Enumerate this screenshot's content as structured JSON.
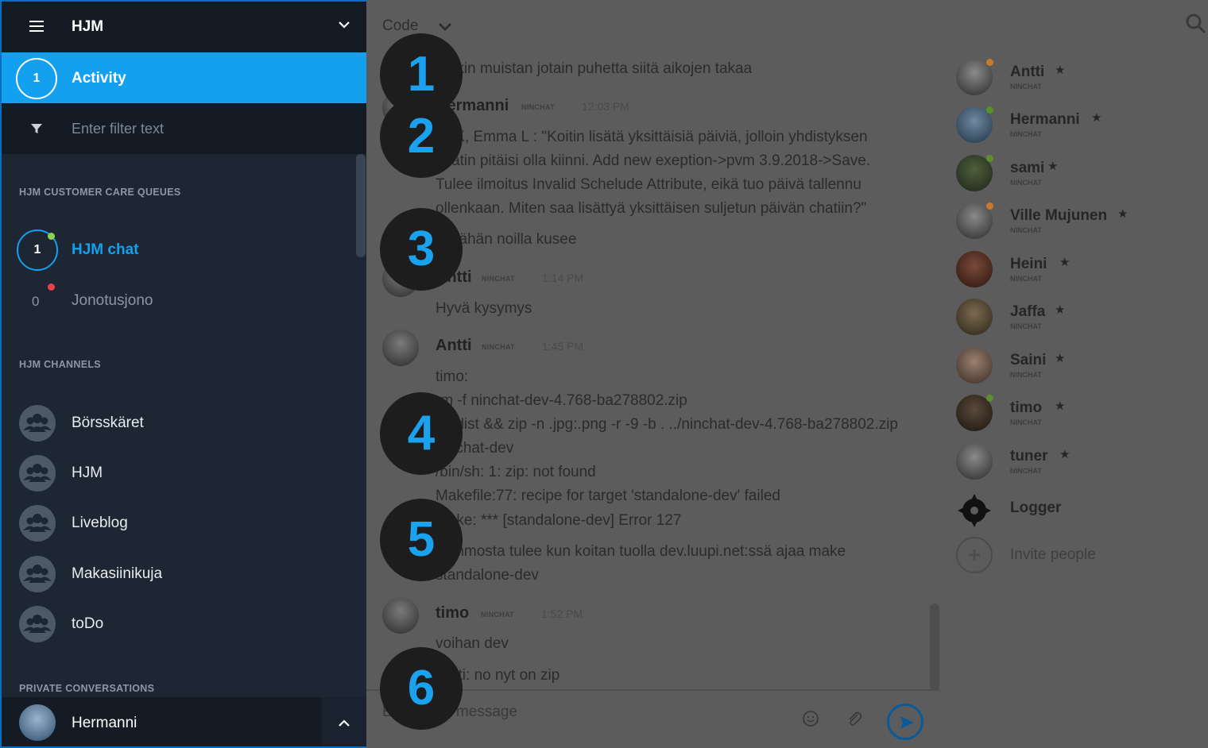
{
  "sidebar": {
    "org_name": "HJM",
    "activity": {
      "count": "1",
      "label": "Activity"
    },
    "filter_placeholder": "Enter filter text",
    "queues_heading": "HJM CUSTOMER CARE QUEUES",
    "queues": [
      {
        "count": "1",
        "label": "HJM chat",
        "status_color": "#8fd14f"
      },
      {
        "count": "0",
        "label": "Jonotusjono",
        "status_color": "#e8404a"
      }
    ],
    "channels_heading": "HJM CHANNELS",
    "channels": [
      {
        "label": "Börsskäret"
      },
      {
        "label": "HJM"
      },
      {
        "label": "Liveblog"
      },
      {
        "label": "Makasiinikuja"
      },
      {
        "label": "toDo"
      }
    ],
    "private_heading": "PRIVATE CONVERSATIONS",
    "current_user": "Hermanni"
  },
  "channel": {
    "title": "Code"
  },
  "messages": {
    "m0": {
      "text": "mäkin muistan jotain puhetta siitä aikojen takaa"
    },
    "m1": {
      "author": "Hermanni",
      "badge": "NINCHAT",
      "time": "12:03 PM",
      "lines": [
        "YTK, Emma L : \"Koitin lisätä yksittäisiä päiviä, jolloin yhdistyksen",
        "chatin pitäisi olla kiinni. Add new exeption->pvm 3.9.2018->Save.",
        "Tulee ilmoitus Invalid Schelude Attribute, eikä tuo päivä tallennu",
        "ollenkaan. Miten saa lisättyä yksittäisen suljetun päivän chatiin?\"",
        "Mikähän noilla kusee"
      ]
    },
    "m2": {
      "author": "Antti",
      "badge": "NINCHAT",
      "time": "1:14 PM",
      "lines": [
        "Hyvä kysymys"
      ]
    },
    "m3": {
      "author": "Antti",
      "badge": "NINCHAT",
      "time": "1:45 PM",
      "lines": [
        "timo:",
        "rm -f ninchat-dev-4.768-ba278802.zip",
        "cd dist && zip -n .jpg:.png -r -9 -b . ../ninchat-dev-4.768-ba278802.zip",
        "ninchat-dev",
        "/bin/sh: 1: zip: not found",
        "Makefile:77: recipe for target 'standalone-dev' failed",
        "make: *** [standalone-dev] Error 127",
        "Tommosta tulee kun koitan tuolla dev.luupi.net:ssä ajaa make",
        "standalone-dev"
      ]
    },
    "m4": {
      "author": "timo",
      "badge": "NINCHAT",
      "time": "1:52 PM",
      "lines": [
        "voihan dev",
        "Antti: no nyt on zip"
      ]
    }
  },
  "composer": {
    "placeholder": "Enter your message"
  },
  "members": [
    {
      "name": "Antti",
      "badge": "NINCHAT",
      "status_color": "#c87a2a"
    },
    {
      "name": "Hermanni",
      "badge": "NINCHAT",
      "status_color": "#5a8f2a"
    },
    {
      "name": "sami",
      "badge": "NINCHAT",
      "status_color": "#5a8f2a"
    },
    {
      "name": "Ville Mujunen",
      "badge": "NINCHAT",
      "status_color": "#c87a2a"
    },
    {
      "name": "Heini",
      "badge": "NINCHAT"
    },
    {
      "name": "Jaffa",
      "badge": "NINCHAT"
    },
    {
      "name": "Saini",
      "badge": "NINCHAT"
    },
    {
      "name": "timo",
      "badge": "NINCHAT",
      "status_color": "#5a8f2a"
    },
    {
      "name": "tuner",
      "badge": "NINCHAT"
    }
  ],
  "logger": {
    "name": "Logger"
  },
  "invite": {
    "label": "Invite people"
  },
  "markers": [
    "1",
    "2",
    "3",
    "4",
    "5",
    "6"
  ],
  "colors": {
    "accent": "#13a0ee",
    "sidebar_bg": "#1d2633",
    "overlay_bg": "#5c5c5c"
  }
}
